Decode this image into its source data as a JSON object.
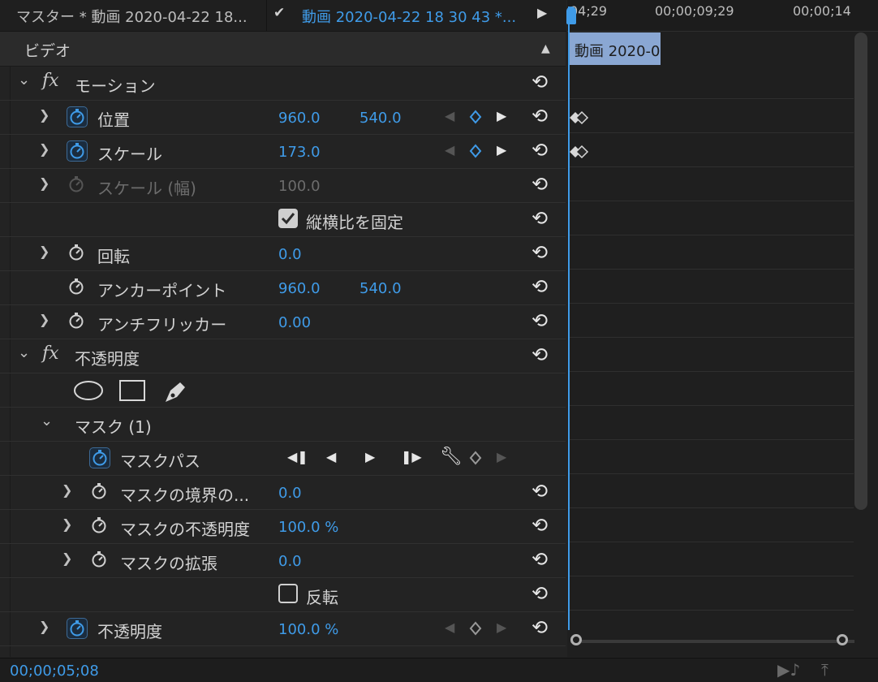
{
  "header": {
    "master_tab": "マスター * 動画 2020-04-22 18...",
    "sequence_tab": "動画 2020-04-22 18 30 43 *..."
  },
  "section": {
    "title": "ビデオ"
  },
  "rows": {
    "motion": {
      "label": "モーション"
    },
    "position": {
      "label": "位置",
      "x": "960.0",
      "y": "540.0"
    },
    "scale": {
      "label": "スケール",
      "value": "173.0"
    },
    "scale_width": {
      "label": "スケール (幅)",
      "value": "100.0"
    },
    "uniform_scale": {
      "label": "縦横比を固定",
      "checked": true
    },
    "rotation": {
      "label": "回転",
      "value": "0.0"
    },
    "anchor": {
      "label": "アンカーポイント",
      "x": "960.0",
      "y": "540.0"
    },
    "antiflicker": {
      "label": "アンチフリッカー",
      "value": "0.00"
    },
    "opacity_fx": {
      "label": "不透明度"
    },
    "mask": {
      "label": "マスク (1)"
    },
    "mask_path": {
      "label": "マスクパス"
    },
    "mask_feather": {
      "label": "マスクの境界の...",
      "value": "0.0"
    },
    "mask_opacity": {
      "label": "マスクの不透明度",
      "value": "100.0 %"
    },
    "mask_expansion": {
      "label": "マスクの拡張",
      "value": "0.0"
    },
    "inverted": {
      "label": "反転",
      "checked": false
    },
    "opacity": {
      "label": "不透明度",
      "value": "100.0 %"
    }
  },
  "timeline": {
    "timecodes": [
      "04;29",
      "00;00;09;29",
      "00;00;14"
    ],
    "clip_label": "動画 2020-0"
  },
  "footer": {
    "timecode": "00;00;05;08"
  },
  "colors": {
    "accent": "#3f9be8",
    "clip": "#8aa7d3",
    "panel": "#232323"
  },
  "icons": [
    "stopwatch-icon",
    "reset-icon",
    "keyframe-diamond-icon",
    "ellipse-mask-icon",
    "rectangle-mask-icon",
    "pen-mask-icon",
    "wrench-icon"
  ]
}
